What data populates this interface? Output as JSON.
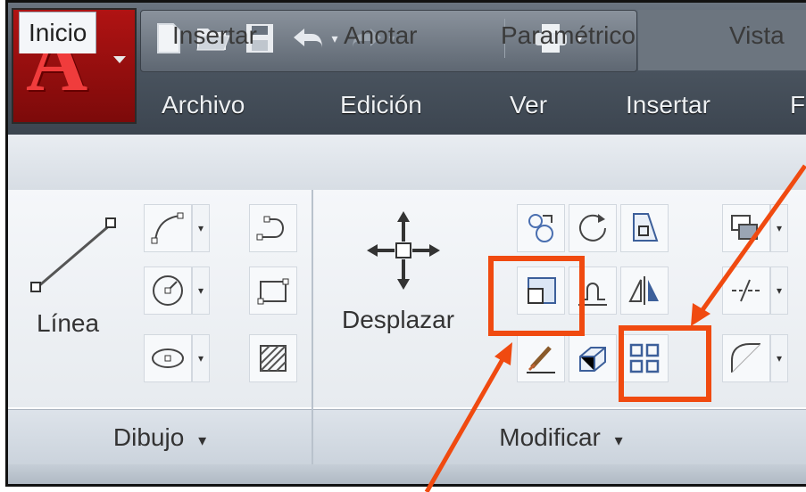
{
  "qat": {
    "icons": [
      "new-icon",
      "open-icon",
      "save-icon",
      "undo-icon",
      "redo-icon",
      "print-icon"
    ]
  },
  "menu": {
    "items": [
      "Archivo",
      "Edición",
      "Ver",
      "Insertar",
      "F"
    ]
  },
  "ribbon": {
    "tabs": [
      "Inicio",
      "Insertar",
      "Anotar",
      "Paramétrico",
      "Vista"
    ],
    "active_tab": "Inicio"
  },
  "dibujo": {
    "big_label": "Línea",
    "panel_title": "Dibujo",
    "panel_arrow": "▾"
  },
  "modificar": {
    "big_label": "Desplazar",
    "panel_title": "Modificar",
    "panel_arrow": "▾"
  },
  "colors": {
    "highlight": "#f04a10",
    "app_red": "#b01313"
  }
}
